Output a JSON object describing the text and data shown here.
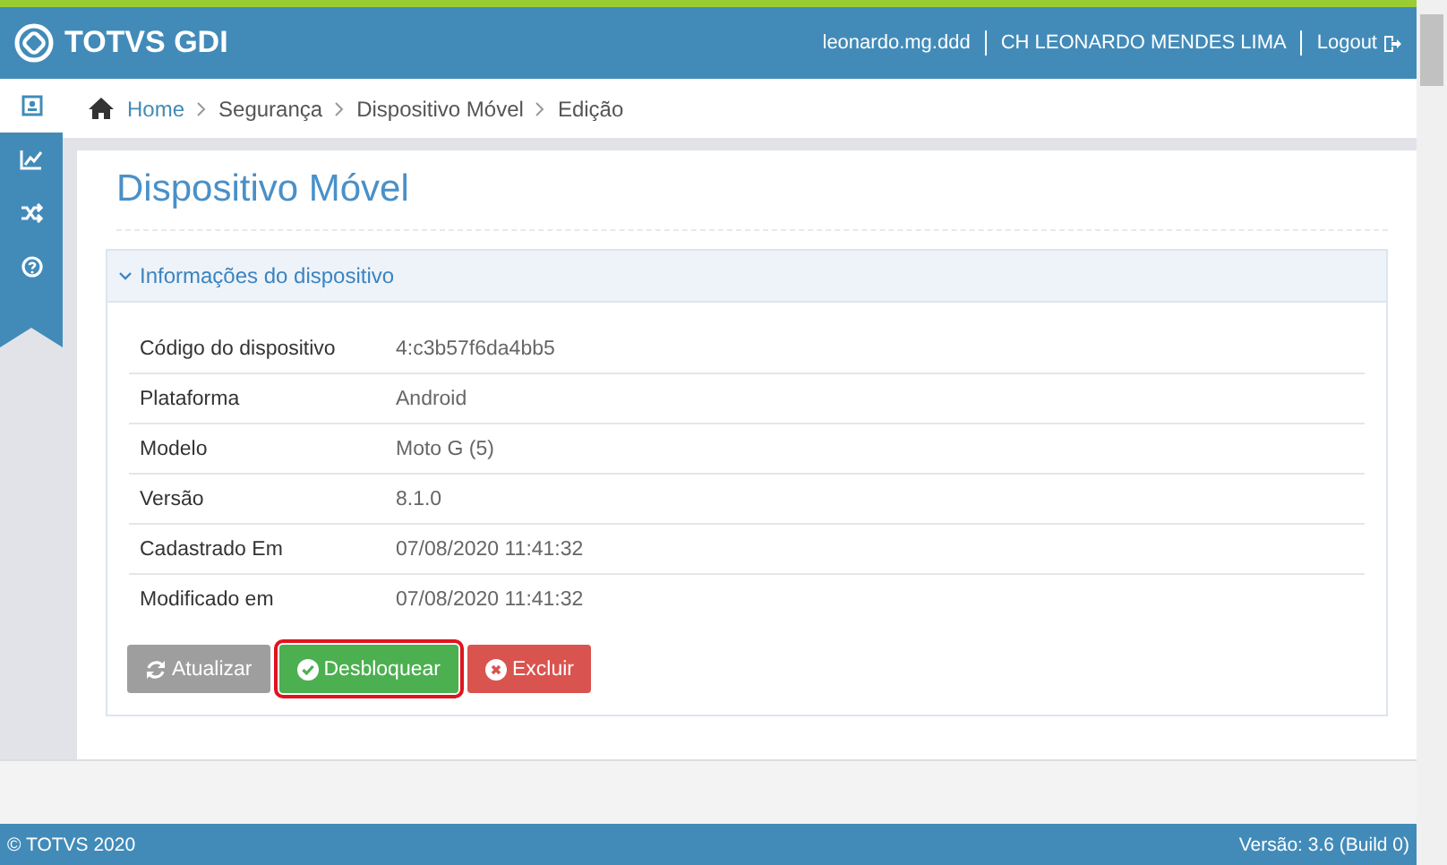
{
  "header": {
    "logo": "TOTVS GDI",
    "user": "leonardo.mg.ddd",
    "company": "CH LEONARDO MENDES LIMA",
    "logout": "Logout"
  },
  "sidebar": {
    "items": [
      {
        "kind": "contact",
        "selected": true
      },
      {
        "kind": "chart",
        "selected": false
      },
      {
        "kind": "shuffle",
        "selected": false
      },
      {
        "kind": "help",
        "selected": false
      }
    ]
  },
  "breadcrumb": [
    "Home",
    "Segurança",
    "Dispositivo Móvel",
    "Edição"
  ],
  "page_title": "Dispositivo Móvel",
  "section": {
    "title": "Informações do dispositivo",
    "expanded": true,
    "rows": [
      {
        "label": "Código do dispositivo",
        "value": "4:c3b57f6da4bb5"
      },
      {
        "label": "Plataforma",
        "value": "Android"
      },
      {
        "label": "Modelo",
        "value": "Moto G (5)"
      },
      {
        "label": "Versão",
        "value": "8.1.0"
      },
      {
        "label": "Cadastrado Em",
        "value": "07/08/2020 11:41:32"
      },
      {
        "label": "Modificado em",
        "value": "07/08/2020 11:41:32"
      }
    ]
  },
  "buttons": [
    {
      "kind": "refresh",
      "label": "Atualizar",
      "highlighted": false
    },
    {
      "kind": "unlock",
      "label": "Desbloquear",
      "highlighted": true
    },
    {
      "kind": "delete",
      "label": "Excluir",
      "highlighted": false
    }
  ],
  "footer": {
    "copyright": "© TOTVS 2020",
    "version": "Versão: 3.6 (Build 0)"
  }
}
